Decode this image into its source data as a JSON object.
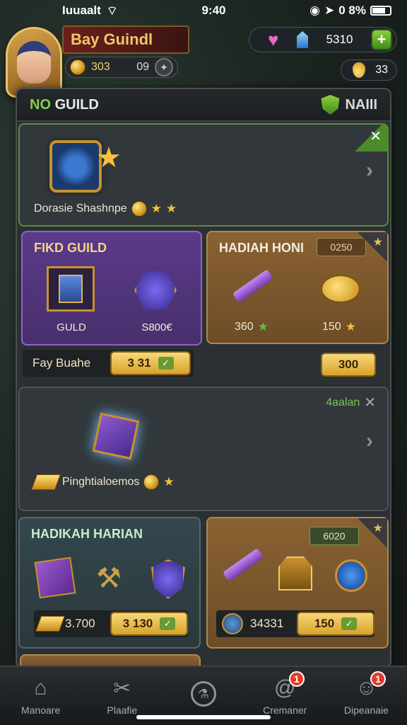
{
  "status": {
    "carrier": "Iuuaalt",
    "time": "9:40",
    "battery_text": "0 8%"
  },
  "player": {
    "name": "Bay Guindl",
    "coins": "303",
    "level": "09"
  },
  "resources": {
    "gems": "5310",
    "gold": "33"
  },
  "panel": {
    "title_prefix": "NO",
    "title": "GUILD",
    "right_label": "NAIII"
  },
  "card1": {
    "label": "Dorasie Shashnpe"
  },
  "card_find_guild": {
    "title": "FIKD GUILD",
    "item1_label": "GULD",
    "item2_label": "S800€",
    "price_label": "Fay Buahe",
    "price_value": "3 31"
  },
  "card_hadiah": {
    "title": "HADIAH HONI",
    "tag": "0250",
    "item1_count": "360",
    "item2_count": "150",
    "button": "300"
  },
  "card3": {
    "corner_label": "4aalan",
    "label": "Pinghtialoemos"
  },
  "card_harian": {
    "title": "HADIKAH HARIAN",
    "price_label": "3.700",
    "price_value": "3 130"
  },
  "card_last": {
    "tag": "6020",
    "price_label": "34331",
    "price_value": "150"
  },
  "nav": {
    "items": [
      {
        "label": "Manoare",
        "icon": "home-icon",
        "badge": ""
      },
      {
        "label": "Plaafie",
        "icon": "tools-icon",
        "badge": ""
      },
      {
        "label": "",
        "icon": "potion-icon",
        "badge": ""
      },
      {
        "label": "Cremaner",
        "icon": "at-icon",
        "badge": "1"
      },
      {
        "label": "Dipeanaie",
        "icon": "friends-icon",
        "badge": "1"
      }
    ]
  }
}
